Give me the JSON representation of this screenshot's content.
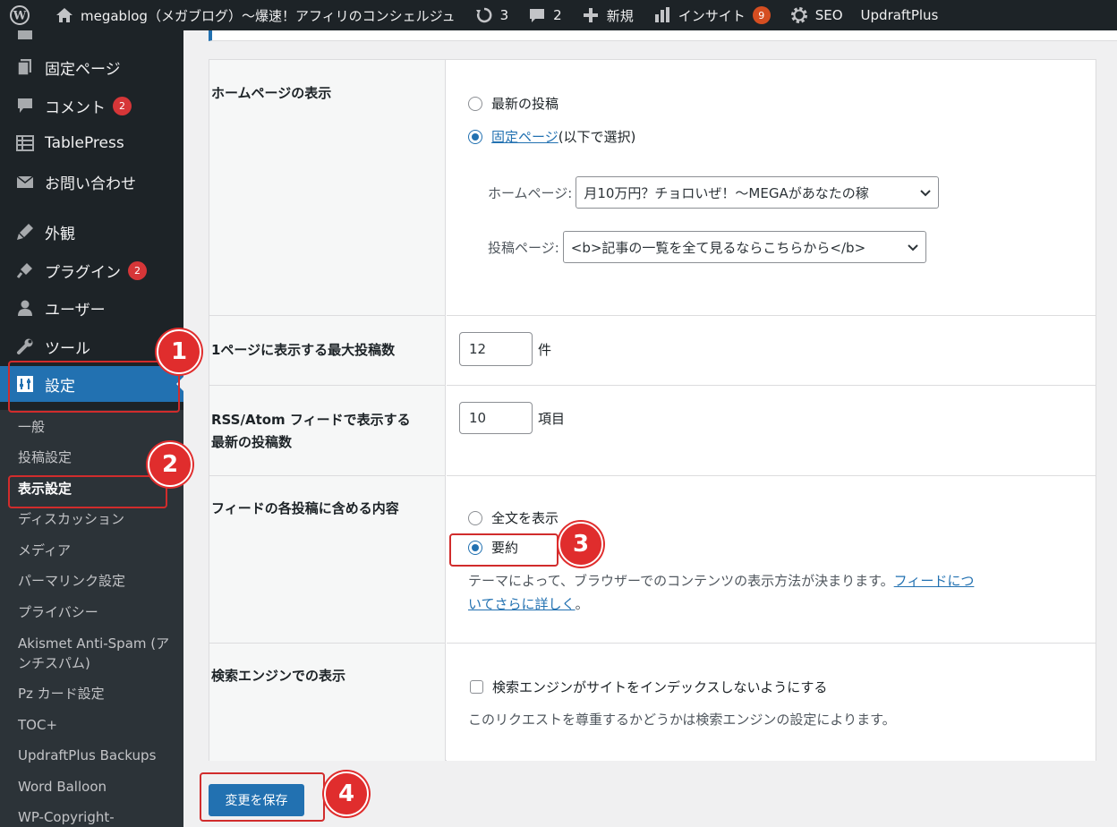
{
  "adminbar": {
    "site_title": "megablog（メガブログ）〜爆速！アフィリのコンシェルジュ",
    "updates_count": "3",
    "comments_count": "2",
    "new_label": "新規",
    "insights_label": "インサイト",
    "insights_badge": "9",
    "seo_label": "SEO",
    "updraft_label": "UpdraftPlus"
  },
  "sidebar": {
    "items": [
      {
        "label": "固定ページ",
        "icon": "pages-icon"
      },
      {
        "label": "コメント",
        "icon": "comment-icon",
        "badge": "2"
      },
      {
        "label": "TablePress",
        "icon": "table-icon"
      },
      {
        "label": "お問い合わせ",
        "icon": "mail-icon"
      },
      {
        "label": "外観",
        "icon": "appearance-icon"
      },
      {
        "label": "プラグイン",
        "icon": "plugin-icon",
        "badge": "2"
      },
      {
        "label": "ユーザー",
        "icon": "user-icon"
      },
      {
        "label": "ツール",
        "icon": "wrench-icon"
      },
      {
        "label": "設定",
        "icon": "settings-icon"
      }
    ],
    "submenu": [
      "一般",
      "投稿設定",
      "表示設定",
      "ディスカッション",
      "メディア",
      "パーマリンク設定",
      "プライバシー",
      "Akismet Anti-Spam (アンチスパム)",
      "Pz カード設定",
      "TOC+",
      "UpdraftPlus Backups",
      "Word Balloon",
      "WP-Copyright-"
    ]
  },
  "settings": {
    "homepage": {
      "label": "ホームページの表示",
      "opt_latest": "最新の投稿",
      "opt_static_link": "固定ページ",
      "opt_static_suffix": " (以下で選択)",
      "homepage_label": "ホームページ:",
      "homepage_value": "月10万円？チョロいぜ！〜MEGAがあなたの稼",
      "posts_page_label": "投稿ページ:",
      "posts_page_value": "<b>記事の一覧を全て見るならこちらから</b>"
    },
    "posts_per_page": {
      "label": "1ページに表示する最大投稿数",
      "value": "12",
      "unit": "件"
    },
    "rss": {
      "label_line1": "RSS/Atom フィードで表示する",
      "label_line2": "最新の投稿数",
      "value": "10",
      "unit": "項目"
    },
    "feed_content": {
      "label": "フィードの各投稿に含める内容",
      "opt_full": "全文を表示",
      "opt_summary": "要約",
      "desc_prefix": "テーマによって、ブラウザーでのコンテンツの表示方法が決まります。",
      "desc_link_line1": "フィードにつ",
      "desc_link_line2": "いてさらに詳しく",
      "desc_suffix": "。"
    },
    "search": {
      "label": "検索エンジンでの表示",
      "checkbox_label": "検索エンジンがサイトをインデックスしないようにする",
      "desc": "このリクエストを尊重するかどうかは検索エンジンの設定によります。"
    },
    "save_button": "変更を保存"
  },
  "annotations": [
    "1",
    "2",
    "3",
    "4"
  ],
  "colors": {
    "admin_dark": "#1d2327",
    "submenu_bg": "#2c3338",
    "accent_blue": "#2271b1",
    "badge_red": "#d63638",
    "marker_red": "#e02d2d"
  }
}
